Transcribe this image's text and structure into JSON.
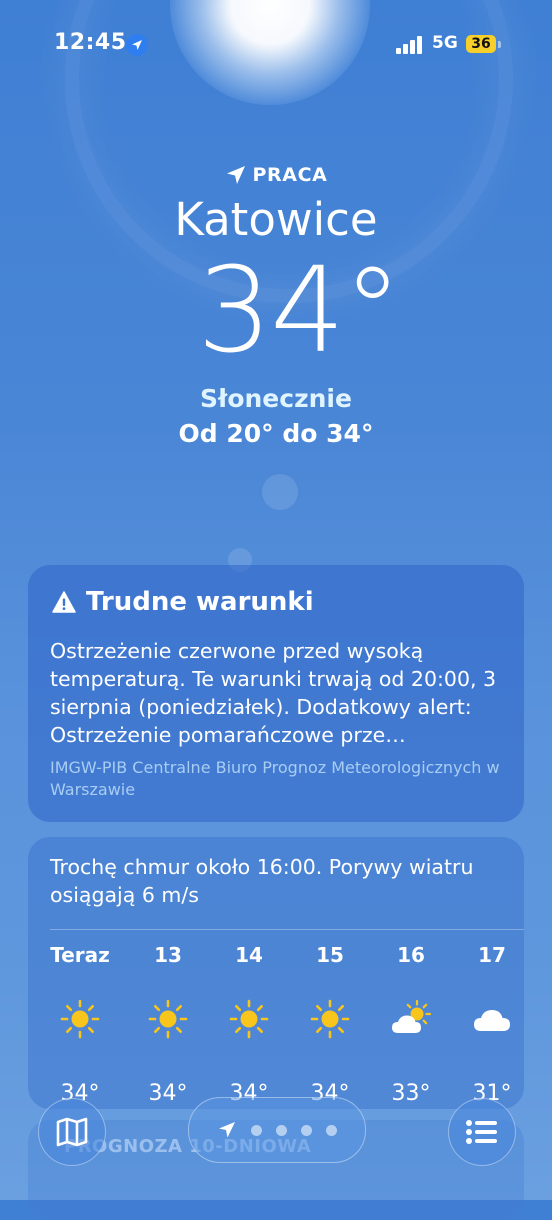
{
  "status_bar": {
    "time": "12:45",
    "network": "5G",
    "battery": "36",
    "location_icon": "location-arrow-icon",
    "signal_icon": "cellular-signal-icon"
  },
  "location": {
    "label": "PRACA",
    "city": "Katowice"
  },
  "current": {
    "temperature": "34°",
    "condition": "Słonecznie",
    "range": "Od 20° do 34°"
  },
  "alert": {
    "icon": "warning-triangle-icon",
    "title": "Trudne warunki",
    "body": "Ostrzeżenie czerwone przed wysoką temperaturą. Te warunki trwają od 20:00, 3 sierpnia (poniedziałek). Dodatkowy alert: Ostrzeżenie pomarańczowe prze…",
    "source": "IMGW-PIB Centralne Biuro Prognoz Meteorologicznych w Warszawie"
  },
  "hourly": {
    "summary": "Trochę chmur około 16:00. Porywy wiatru osiągają 6 m/s",
    "hours": [
      {
        "label": "Teraz",
        "icon": "sun-icon",
        "temp": "34°"
      },
      {
        "label": "13",
        "icon": "sun-icon",
        "temp": "34°"
      },
      {
        "label": "14",
        "icon": "sun-icon",
        "temp": "34°"
      },
      {
        "label": "15",
        "icon": "sun-icon",
        "temp": "34°"
      },
      {
        "label": "16",
        "icon": "partly-cloudy-icon",
        "temp": "33°"
      },
      {
        "label": "17",
        "icon": "cloud-icon",
        "temp": "31°"
      }
    ]
  },
  "next_section": {
    "label": "PROGNOZA 10-DNIOWA"
  },
  "bottom_bar": {
    "map_icon": "map-icon",
    "list_icon": "list-icon",
    "pages": 5,
    "current_page": 1
  },
  "colors": {
    "sky_top": "#3f7fd4",
    "sky_bottom": "#6aa0e0",
    "sun_yellow": "#f7c51b",
    "battery_yellow": "#f6cf2a",
    "location_blue": "#2f7ef0",
    "condition_text": "#dff4ff",
    "source_text": "#a8cdf3"
  }
}
